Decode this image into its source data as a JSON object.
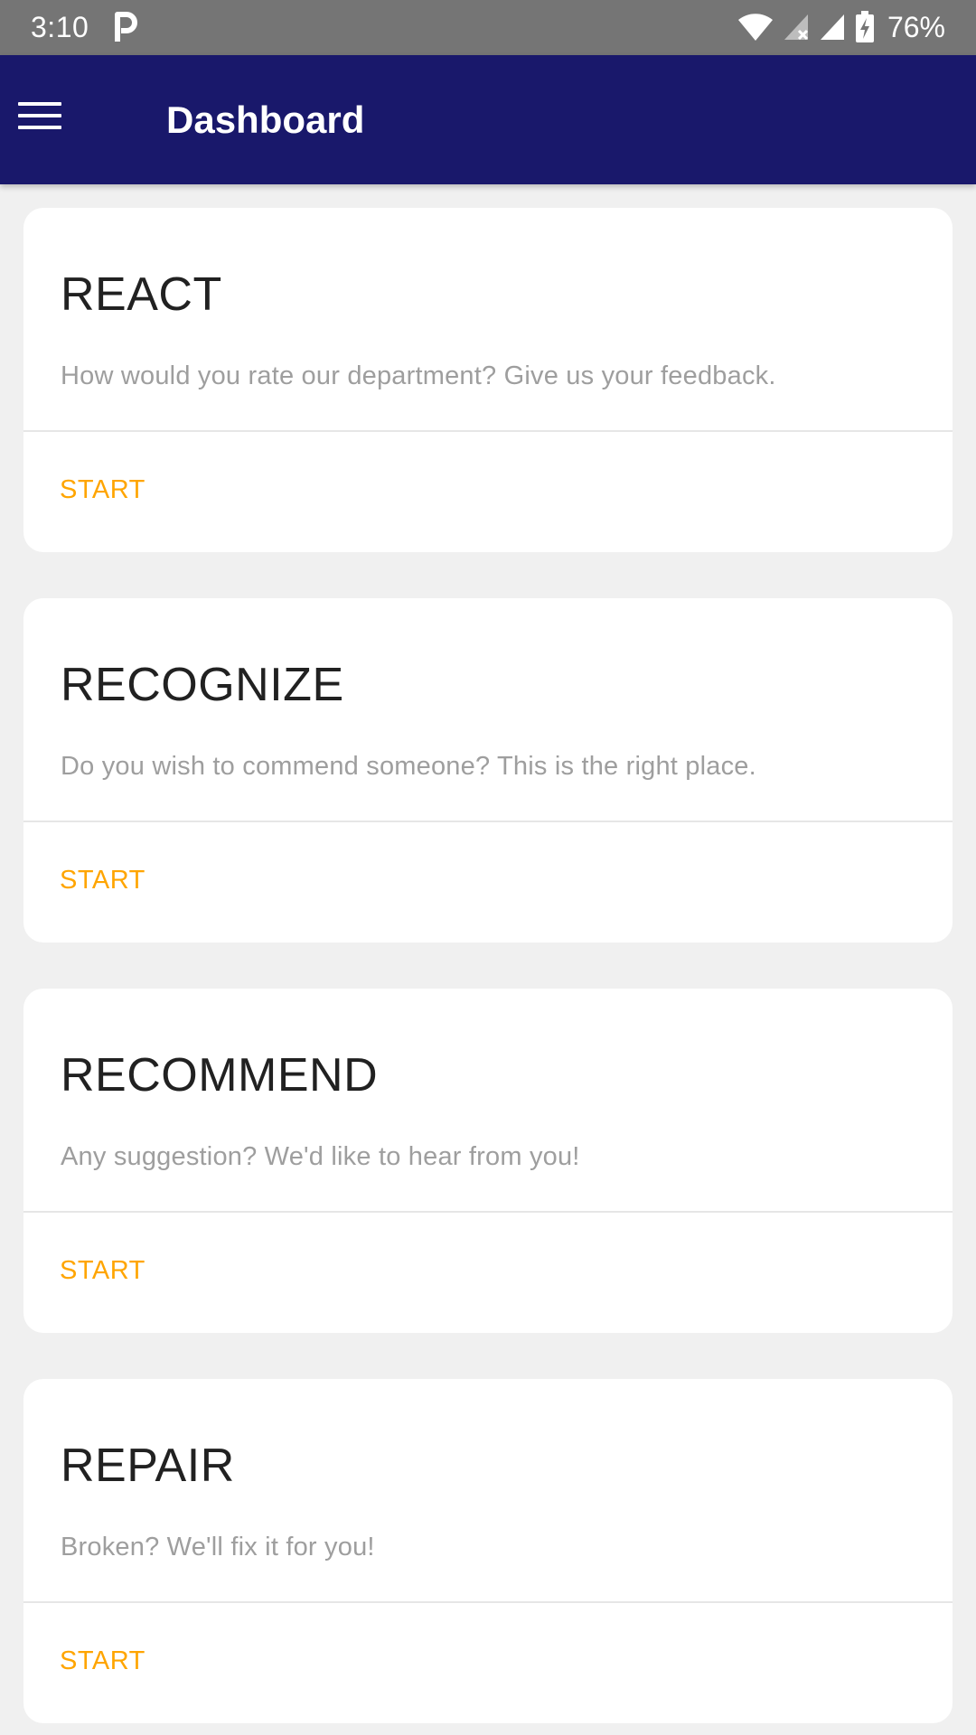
{
  "status_bar": {
    "time": "3:10",
    "battery": "76%",
    "icons": [
      "parking-app-icon",
      "wifi-icon",
      "signal-no-sim-icon",
      "signal-icon",
      "battery-charging-icon"
    ]
  },
  "app_bar": {
    "title": "Dashboard",
    "menu_icon": "hamburger-menu-icon",
    "background_color": "#19186b"
  },
  "cards": [
    {
      "title": "REACT",
      "description": "How would you rate our department? Give us your feedback.",
      "action": "START"
    },
    {
      "title": "RECOGNIZE",
      "description": "Do you wish to commend someone? This is the right place.",
      "action": "START"
    },
    {
      "title": "RECOMMEND",
      "description": "Any suggestion? We'd like to hear from you!",
      "action": "START"
    },
    {
      "title": "REPAIR",
      "description": "Broken? We'll fix it for you!",
      "action": "START"
    }
  ],
  "colors": {
    "accent": "#ffa500",
    "background": "#f0f0f0",
    "status_bar": "#757575"
  }
}
